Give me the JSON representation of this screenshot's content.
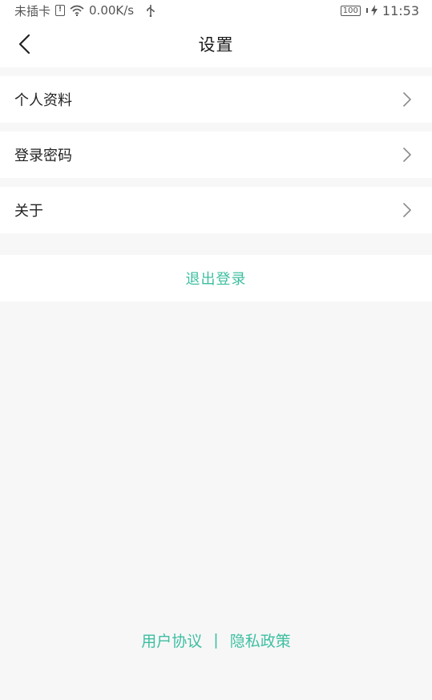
{
  "status_bar": {
    "carrier": "未插卡",
    "net_speed": "0.00K/s",
    "battery": "100",
    "time": "11:53"
  },
  "header": {
    "title": "设置"
  },
  "menu": {
    "items": [
      {
        "label": "个人资料"
      },
      {
        "label": "登录密码"
      },
      {
        "label": "关于"
      }
    ]
  },
  "logout": {
    "label": "退出登录"
  },
  "footer": {
    "user_agreement": "用户协议",
    "separator": "|",
    "privacy_policy": "隐私政策"
  },
  "colors": {
    "accent": "#3dbfa0",
    "background": "#f7f7f8"
  }
}
